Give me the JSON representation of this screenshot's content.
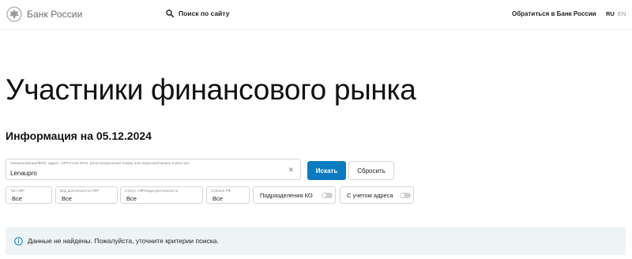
{
  "header": {
    "logo_text": "Банк России",
    "search_label": "Поиск по сайту",
    "contact_label": "Обратиться в Банк России",
    "lang_ru": "RU",
    "lang_en": "EN"
  },
  "main": {
    "title": "Участники финансового рынка",
    "subtitle": "Информация на 05.12.2024"
  },
  "search": {
    "field_label": "Наименование/ФИО, адрес, ОГРН или ИНН, регистрационный номер или лицензия/запись в реестре",
    "field_value": "Lenaupro",
    "clear_icon": "✕",
    "search_button": "Искать",
    "reset_button": "Сбросить"
  },
  "filters": {
    "type": {
      "label": "Тип УФР",
      "value": "Все"
    },
    "activity": {
      "label": "Вид деятельности УФР",
      "value": "Все"
    },
    "status": {
      "label": "Статус УФР/вида деятельности",
      "value": "Все"
    },
    "region": {
      "label": "Субъект РФ",
      "value": "Все"
    },
    "toggle_ko": {
      "label": "Подразделения КО",
      "on": false
    },
    "toggle_address": {
      "label": "С учетом адреса",
      "on": false
    }
  },
  "notice": {
    "text": "Данные не найдены. Пожалуйста, уточните критерии поиска."
  },
  "colors": {
    "accent": "#0a7bc1",
    "notice_bg": "#eef3f6",
    "border": "#d7d7d7"
  },
  "icons": {
    "logo": "double-headed-eagle-icon",
    "search": "search-icon",
    "clear": "close-icon",
    "notice": "info-icon"
  }
}
